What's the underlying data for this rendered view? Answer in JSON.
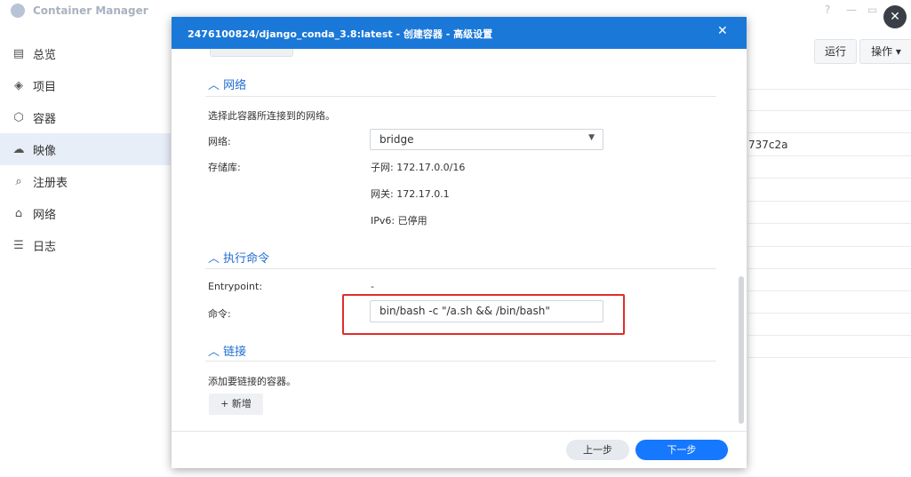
{
  "app": {
    "title": "Container Manager",
    "controls": {
      "help": "?",
      "minimize": "—",
      "maximize": "▭",
      "close": "✕"
    }
  },
  "sidebar": {
    "items": [
      {
        "label": "总览",
        "icon": "overview-icon",
        "glyph": "▤"
      },
      {
        "label": "项目",
        "icon": "project-icon",
        "glyph": "◈"
      },
      {
        "label": "容器",
        "icon": "container-icon",
        "glyph": "⬡"
      },
      {
        "label": "映像",
        "icon": "image-icon",
        "glyph": "☁",
        "active": true
      },
      {
        "label": "注册表",
        "icon": "registry-icon",
        "glyph": "⌕"
      },
      {
        "label": "网络",
        "icon": "network-icon",
        "glyph": "⌂"
      },
      {
        "label": "日志",
        "icon": "log-icon",
        "glyph": "☰"
      }
    ]
  },
  "background": {
    "run_label": "运行",
    "action_label": "操作 ▾",
    "hash_fragment": "737c2a"
  },
  "modal": {
    "title": "2476100824/django_conda_3.8:latest - 创建容器 - 高级设置",
    "close": "✕",
    "network_section": {
      "heading": "网络",
      "description": "选择此容器所连接到的网络。",
      "network_label": "网络:",
      "network_value": "bridge",
      "storage_label": "存储库:",
      "subnet": "子网: 172.17.0.0/16",
      "gateway": "网关: 172.17.0.1",
      "ipv6": "IPv6: 已停用"
    },
    "exec_section": {
      "heading": "执行命令",
      "entrypoint_label": "Entrypoint:",
      "entrypoint_value": "-",
      "command_label": "命令:",
      "command_value": "bin/bash -c \"/a.sh && /bin/bash\""
    },
    "link_section": {
      "heading": "链接",
      "description": "添加要链接的容器。",
      "add_label": "+ 新增"
    },
    "footer": {
      "prev_label": "上一步",
      "next_label": "下一步"
    }
  },
  "colors": {
    "accent": "#1677ff",
    "header": "#1a78d8",
    "highlight": "#e02c2c",
    "section": "#1f6dd1"
  }
}
